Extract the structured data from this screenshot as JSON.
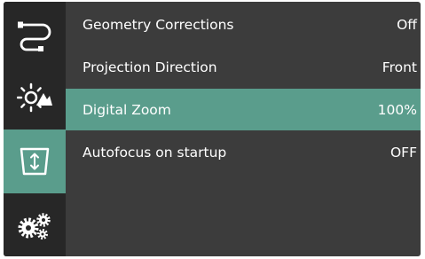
{
  "sidebar": {
    "items": [
      {
        "icon": "cable-connector-icon"
      },
      {
        "icon": "brightness-picture-icon"
      },
      {
        "icon": "keystone-zoom-icon",
        "active": true
      },
      {
        "icon": "settings-gears-icon"
      }
    ]
  },
  "menu": {
    "rows": [
      {
        "label": "Geometry Corrections",
        "value": "Off"
      },
      {
        "label": "Projection Direction",
        "value": "Front"
      },
      {
        "label": "Digital Zoom",
        "value": "100%",
        "selected": true
      },
      {
        "label": "Autofocus on startup",
        "value": "OFF"
      }
    ]
  },
  "colors": {
    "accent": "#5a9d8c",
    "panel": "#3c3c3c",
    "sidebar": "#272727",
    "text": "#ffffff"
  }
}
